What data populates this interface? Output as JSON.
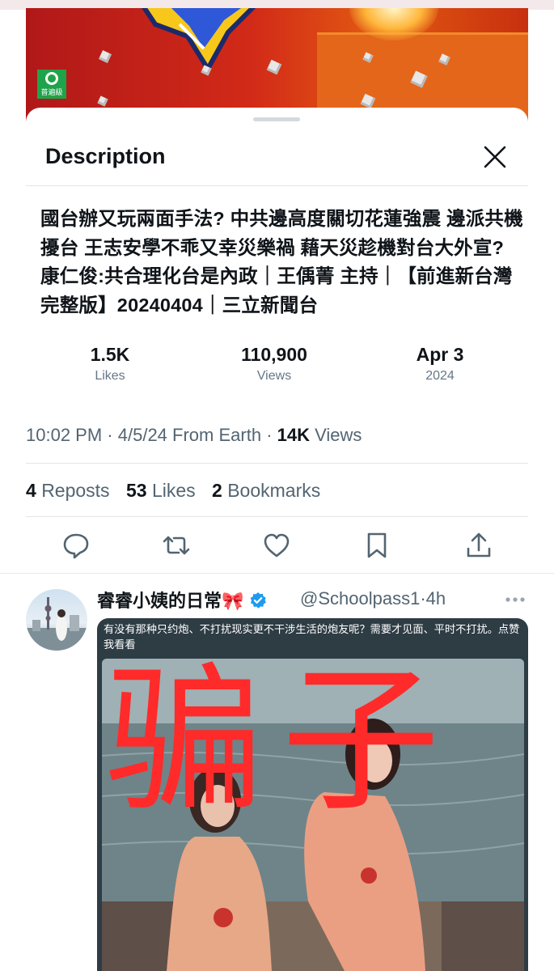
{
  "video": {
    "rating_badge": "普遍級"
  },
  "sheet": {
    "title": "Description",
    "close_icon": "close-icon",
    "description_text": "國台辦又玩兩面手法? 中共邊高度關切花蓮強震 邊派共機擾台 王志安學不乖又幸災樂禍 藉天災趁機對台大外宣? 康仁俊:共合理化台是內政｜王偊菁 主持｜【前進新台灣 完整版】20240404｜三立新聞台",
    "stats": [
      {
        "value": "1.5K",
        "label": "Likes"
      },
      {
        "value": "110,900",
        "label": "Views"
      },
      {
        "value": "Apr 3",
        "label": "2024"
      }
    ]
  },
  "tweet_meta": {
    "time": "10:02 PM",
    "date": "4/5/24",
    "source": "From Earth",
    "views_count": "14K",
    "views_label": "Views"
  },
  "engagement": {
    "reposts_count": "4",
    "reposts_label": "Reposts",
    "likes_count": "53",
    "likes_label": "Likes",
    "bookmarks_count": "2",
    "bookmarks_label": "Bookmarks"
  },
  "actions": [
    "reply-icon",
    "repost-icon",
    "like-icon",
    "bookmark-icon",
    "share-icon"
  ],
  "reply": {
    "author_name": "睿睿小姨的日常🎀",
    "verified_icon": "verified-badge-icon",
    "handle": "@Schoolpass1",
    "separator": "·",
    "age": "4h",
    "more_icon": "more-icon",
    "image_caption": "有没有那种只约炮、不打扰现实更不干涉生活的炮友呢？需要才见面、平时不打扰。点赞我看看",
    "overlay_text": "骗子"
  },
  "colors": {
    "accent_blue": "#1d9bf0",
    "secondary_text": "#536471",
    "overlay_red": "#ff2b2b"
  }
}
